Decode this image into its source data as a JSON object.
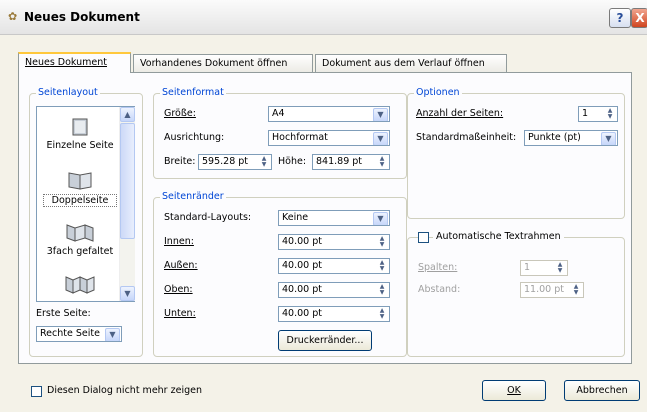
{
  "window": {
    "title": "Neues Dokument",
    "help": "?",
    "close": "X"
  },
  "tabs": [
    {
      "label": "Neues Dokument",
      "active": true
    },
    {
      "label": "Vorhandenes Dokument öffnen",
      "active": false
    },
    {
      "label": "Dokument aus dem Verlauf öffnen",
      "active": false
    }
  ],
  "seitenlayout": {
    "title": "Seitenlayout",
    "items": [
      {
        "label": "Einzelne Seite",
        "icon": "single-page-icon"
      },
      {
        "label": "Doppelseite",
        "icon": "double-page-icon",
        "selected": true
      },
      {
        "label": "3fach gefaltet",
        "icon": "tri-fold-icon"
      },
      {
        "label": "",
        "icon": "quad-fold-icon"
      }
    ],
    "first_page_label": "Erste Seite:",
    "first_page_value": "Rechte Seite"
  },
  "seitenformat": {
    "title": "Seitenformat",
    "size_label": "Größe:",
    "size_value": "A4",
    "orientation_label": "Ausrichtung:",
    "orientation_value": "Hochformat",
    "width_label": "Breite:",
    "width_value": "595.28 pt",
    "height_label": "Höhe:",
    "height_value": "841.89 pt"
  },
  "seitenraender": {
    "title": "Seitenränder",
    "preset_label": "Standard-Layouts:",
    "preset_value": "Keine",
    "inner_label": "Innen:",
    "inner_value": "40.00 pt",
    "outer_label": "Außen:",
    "outer_value": "40.00 pt",
    "top_label": "Oben:",
    "top_value": "40.00 pt",
    "bottom_label": "Unten:",
    "bottom_value": "40.00 pt",
    "printer_button": "Druckerränder..."
  },
  "optionen": {
    "title": "Optionen",
    "pages_label": "Anzahl der Seiten:",
    "pages_value": "1",
    "unit_label": "Standardmaßeinheit:",
    "unit_value": "Punkte (pt)"
  },
  "textframes": {
    "label": "Automatische Textrahmen",
    "checked": false,
    "columns_label": "Spalten:",
    "columns_value": "1",
    "gap_label": "Abstand:",
    "gap_value": "11.00 pt"
  },
  "footer": {
    "dont_show_label": "Diesen Dialog nicht mehr zeigen",
    "ok": "OK",
    "cancel": "Abbrechen"
  }
}
